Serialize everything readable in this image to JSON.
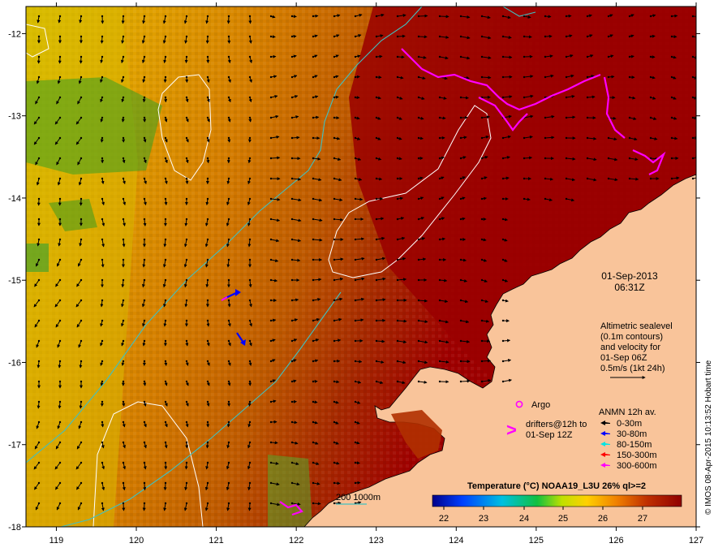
{
  "map": {
    "lon_ticks": [
      "119",
      "120",
      "121",
      "122",
      "123",
      "124",
      "125",
      "126",
      "127"
    ],
    "lat_ticks": [
      "-12",
      "-13",
      "-14",
      "-15",
      "-16",
      "-17",
      "-18"
    ],
    "lon_range": [
      118.62,
      127.0
    ],
    "lat_range": [
      -11.67,
      -18.0
    ]
  },
  "timestamp": {
    "date": "01-Sep-2013",
    "time": "06:31Z"
  },
  "altimetry": {
    "lines": [
      "Altimetric sealevel",
      "(0.1m contours)",
      "and velocity for",
      "01-Sep 06Z",
      "0.5m/s (1kt 24h)"
    ]
  },
  "argo": {
    "label": "Argo",
    "color": "#ff00ff"
  },
  "drifters": {
    "lines": [
      "drifters@12h to",
      "01-Sep 12Z"
    ],
    "color": "#ff00ff"
  },
  "anmn": {
    "title": "ANMN 12h av.",
    "items": [
      {
        "label": "0-30m",
        "color": "#000000"
      },
      {
        "label": "30-80m",
        "color": "#0000ff"
      },
      {
        "label": "80-150m",
        "color": "#00e5e5"
      },
      {
        "label": "150-300m",
        "color": "#ff0000"
      },
      {
        "label": "300-600m",
        "color": "#ff00ff"
      }
    ]
  },
  "isobath": {
    "label": "200  1000m",
    "color": "#40c0c0"
  },
  "colorbar": {
    "title": "Temperature (°C) NOAA19_L3U 26% ql>=2",
    "ticks": [
      "22",
      "23",
      "24",
      "25",
      "26",
      "27"
    ]
  },
  "credit": "© IMOS 08-Apr-2015 10:13:52 Hobart time",
  "colors": {
    "land": "#f9c49a",
    "ocean_hot": "#a00000",
    "isobath": "#40c0c0"
  }
}
